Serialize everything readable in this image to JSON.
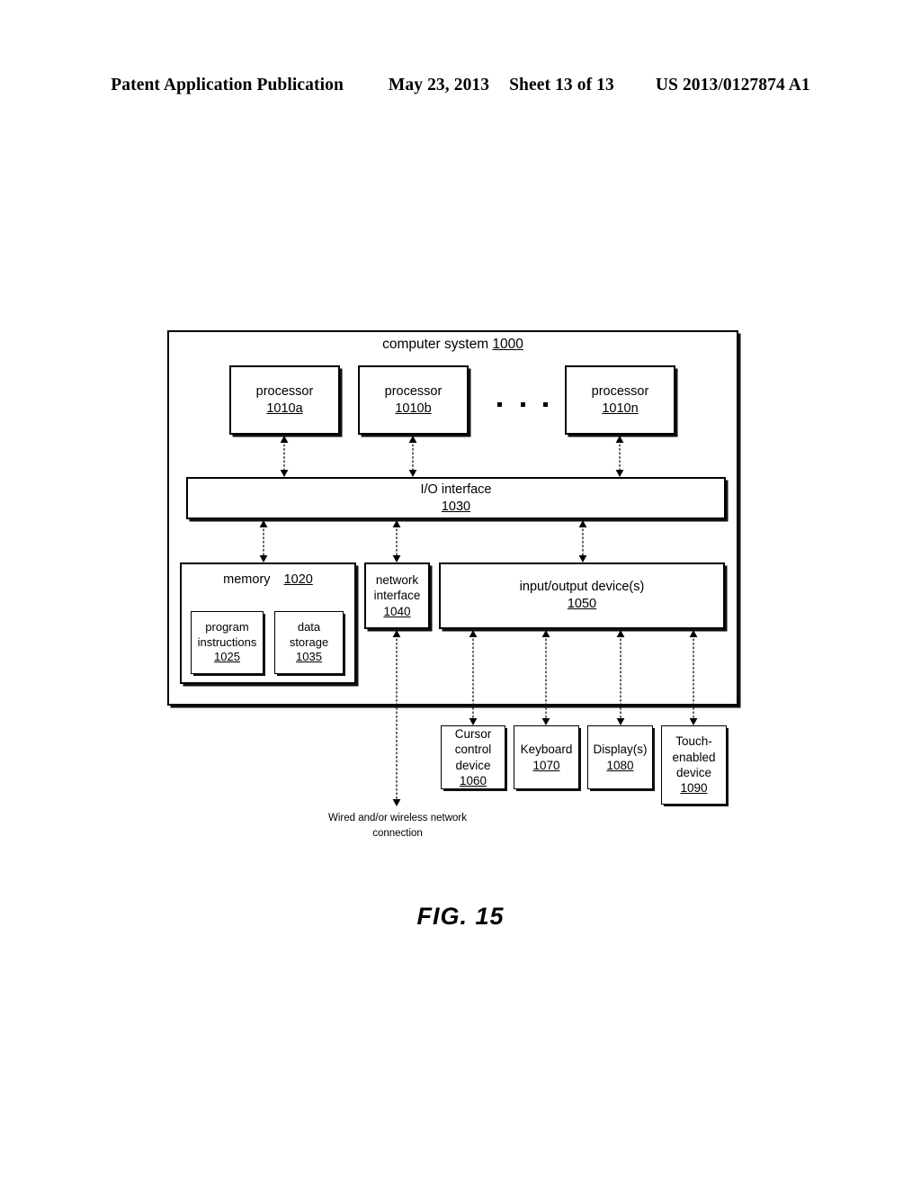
{
  "header": {
    "publication": "Patent Application Publication",
    "date": "May 23, 2013",
    "sheet": "Sheet 13 of 13",
    "patent_number": "US 2013/0127874 A1"
  },
  "figure": {
    "label": "FIG. 15",
    "system": {
      "title": "computer system",
      "ref": "1000"
    },
    "processors": [
      {
        "label": "processor",
        "ref": "1010a"
      },
      {
        "label": "processor",
        "ref": "1010b"
      },
      {
        "label": "processor",
        "ref": "1010n"
      }
    ],
    "ellipsis": "· · ·",
    "io_interface": {
      "label": "I/O interface",
      "ref": "1030"
    },
    "memory": {
      "label": "memory",
      "ref": "1020",
      "children": [
        {
          "line1": "program",
          "line2": "instructions",
          "ref": "1025"
        },
        {
          "line1": "data",
          "line2": "storage",
          "ref": "1035"
        }
      ]
    },
    "network_interface": {
      "line1": "network",
      "line2": "interface",
      "ref": "1040"
    },
    "io_devices": {
      "label": "input/output device(s)",
      "ref": "1050"
    },
    "peripherals": [
      {
        "line1": "Cursor",
        "line2": "control",
        "line3": "device",
        "ref": "1060"
      },
      {
        "line1": "Keyboard",
        "line2": "",
        "line3": "",
        "ref": "1070"
      },
      {
        "line1": "Display(s)",
        "line2": "",
        "line3": "",
        "ref": "1080"
      },
      {
        "line1": "Touch-",
        "line2": "enabled",
        "line3": "device",
        "ref": "1090"
      }
    ],
    "network_caption": {
      "line1": "Wired and/or",
      "line2": "wireless network",
      "line3": "connection"
    }
  },
  "colors": {
    "ink": "#000000",
    "paper": "#ffffff"
  }
}
